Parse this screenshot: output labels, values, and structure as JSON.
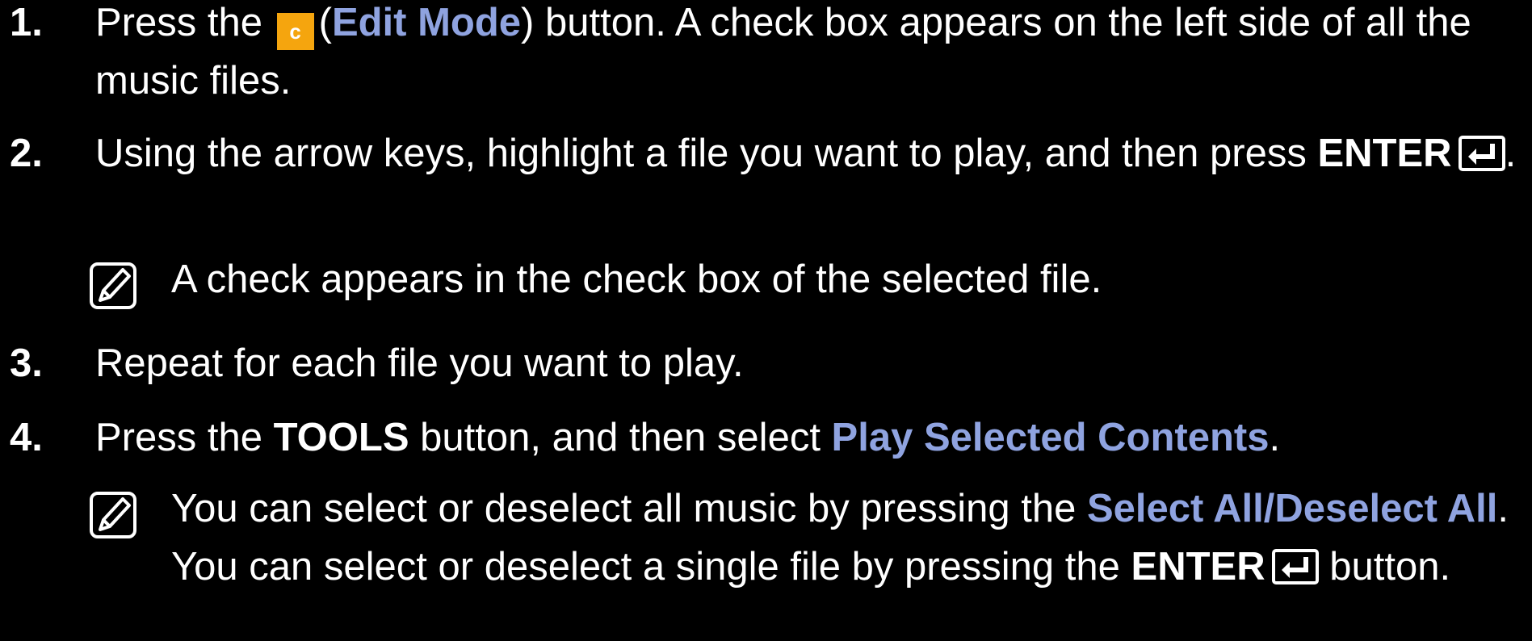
{
  "steps": [
    {
      "number": "1.",
      "line1_before": "Press the ",
      "key_label": "c",
      "paren_open": "(",
      "edit_mode": "Edit Mode",
      "line1_after": ") button. A check box appears on the left side of all the music files."
    },
    {
      "number": "2.",
      "text": "Using the arrow keys, highlight a file you want to play, and then press ",
      "enter_label": "ENTER",
      "end": "."
    },
    {
      "number": "3.",
      "text": "Repeat for each file you want to play."
    },
    {
      "number": "4.",
      "before": "Press the ",
      "tools": "TOOLS",
      "middle": " button, and then select ",
      "play_selected": "Play Selected Contents",
      "end": "."
    }
  ],
  "notes": [
    {
      "icon": "note-icon",
      "text": "A check appears in the check box of the selected file."
    },
    {
      "icon": "note-icon",
      "before": "You can select or deselect all music by pressing the ",
      "select_all": "Select All/Deselect All",
      "middle": ". You can select or deselect a single file by pressing the ",
      "enter_label": "ENTER",
      "after": " button."
    }
  ],
  "colors": {
    "background": "#000000",
    "text": "#ffffff",
    "link": "#8fa3e0",
    "key_c": "#f5a50e"
  }
}
